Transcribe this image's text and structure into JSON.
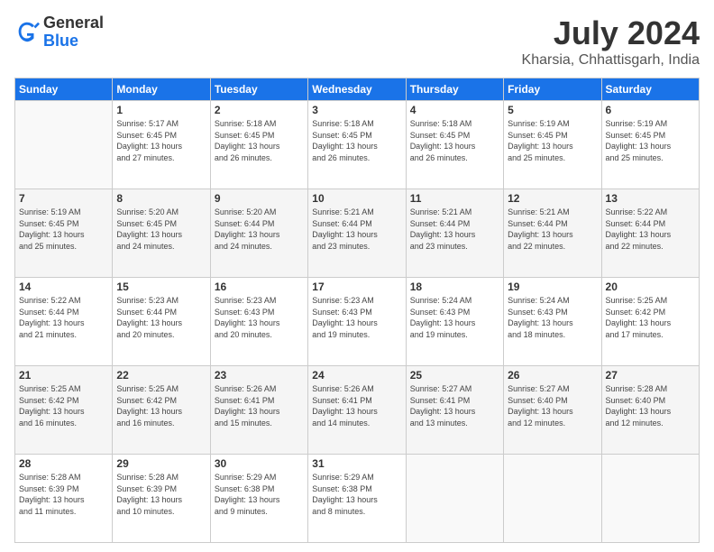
{
  "logo": {
    "general": "General",
    "blue": "Blue"
  },
  "title": "July 2024",
  "subtitle": "Kharsia, Chhattisgarh, India",
  "weekdays": [
    "Sunday",
    "Monday",
    "Tuesday",
    "Wednesday",
    "Thursday",
    "Friday",
    "Saturday"
  ],
  "weeks": [
    [
      {
        "day": "",
        "info": ""
      },
      {
        "day": "1",
        "info": "Sunrise: 5:17 AM\nSunset: 6:45 PM\nDaylight: 13 hours\nand 27 minutes."
      },
      {
        "day": "2",
        "info": "Sunrise: 5:18 AM\nSunset: 6:45 PM\nDaylight: 13 hours\nand 26 minutes."
      },
      {
        "day": "3",
        "info": "Sunrise: 5:18 AM\nSunset: 6:45 PM\nDaylight: 13 hours\nand 26 minutes."
      },
      {
        "day": "4",
        "info": "Sunrise: 5:18 AM\nSunset: 6:45 PM\nDaylight: 13 hours\nand 26 minutes."
      },
      {
        "day": "5",
        "info": "Sunrise: 5:19 AM\nSunset: 6:45 PM\nDaylight: 13 hours\nand 25 minutes."
      },
      {
        "day": "6",
        "info": "Sunrise: 5:19 AM\nSunset: 6:45 PM\nDaylight: 13 hours\nand 25 minutes."
      }
    ],
    [
      {
        "day": "7",
        "info": "Sunrise: 5:19 AM\nSunset: 6:45 PM\nDaylight: 13 hours\nand 25 minutes."
      },
      {
        "day": "8",
        "info": "Sunrise: 5:20 AM\nSunset: 6:45 PM\nDaylight: 13 hours\nand 24 minutes."
      },
      {
        "day": "9",
        "info": "Sunrise: 5:20 AM\nSunset: 6:44 PM\nDaylight: 13 hours\nand 24 minutes."
      },
      {
        "day": "10",
        "info": "Sunrise: 5:21 AM\nSunset: 6:44 PM\nDaylight: 13 hours\nand 23 minutes."
      },
      {
        "day": "11",
        "info": "Sunrise: 5:21 AM\nSunset: 6:44 PM\nDaylight: 13 hours\nand 23 minutes."
      },
      {
        "day": "12",
        "info": "Sunrise: 5:21 AM\nSunset: 6:44 PM\nDaylight: 13 hours\nand 22 minutes."
      },
      {
        "day": "13",
        "info": "Sunrise: 5:22 AM\nSunset: 6:44 PM\nDaylight: 13 hours\nand 22 minutes."
      }
    ],
    [
      {
        "day": "14",
        "info": "Sunrise: 5:22 AM\nSunset: 6:44 PM\nDaylight: 13 hours\nand 21 minutes."
      },
      {
        "day": "15",
        "info": "Sunrise: 5:23 AM\nSunset: 6:44 PM\nDaylight: 13 hours\nand 20 minutes."
      },
      {
        "day": "16",
        "info": "Sunrise: 5:23 AM\nSunset: 6:43 PM\nDaylight: 13 hours\nand 20 minutes."
      },
      {
        "day": "17",
        "info": "Sunrise: 5:23 AM\nSunset: 6:43 PM\nDaylight: 13 hours\nand 19 minutes."
      },
      {
        "day": "18",
        "info": "Sunrise: 5:24 AM\nSunset: 6:43 PM\nDaylight: 13 hours\nand 19 minutes."
      },
      {
        "day": "19",
        "info": "Sunrise: 5:24 AM\nSunset: 6:43 PM\nDaylight: 13 hours\nand 18 minutes."
      },
      {
        "day": "20",
        "info": "Sunrise: 5:25 AM\nSunset: 6:42 PM\nDaylight: 13 hours\nand 17 minutes."
      }
    ],
    [
      {
        "day": "21",
        "info": "Sunrise: 5:25 AM\nSunset: 6:42 PM\nDaylight: 13 hours\nand 16 minutes."
      },
      {
        "day": "22",
        "info": "Sunrise: 5:25 AM\nSunset: 6:42 PM\nDaylight: 13 hours\nand 16 minutes."
      },
      {
        "day": "23",
        "info": "Sunrise: 5:26 AM\nSunset: 6:41 PM\nDaylight: 13 hours\nand 15 minutes."
      },
      {
        "day": "24",
        "info": "Sunrise: 5:26 AM\nSunset: 6:41 PM\nDaylight: 13 hours\nand 14 minutes."
      },
      {
        "day": "25",
        "info": "Sunrise: 5:27 AM\nSunset: 6:41 PM\nDaylight: 13 hours\nand 13 minutes."
      },
      {
        "day": "26",
        "info": "Sunrise: 5:27 AM\nSunset: 6:40 PM\nDaylight: 13 hours\nand 12 minutes."
      },
      {
        "day": "27",
        "info": "Sunrise: 5:28 AM\nSunset: 6:40 PM\nDaylight: 13 hours\nand 12 minutes."
      }
    ],
    [
      {
        "day": "28",
        "info": "Sunrise: 5:28 AM\nSunset: 6:39 PM\nDaylight: 13 hours\nand 11 minutes."
      },
      {
        "day": "29",
        "info": "Sunrise: 5:28 AM\nSunset: 6:39 PM\nDaylight: 13 hours\nand 10 minutes."
      },
      {
        "day": "30",
        "info": "Sunrise: 5:29 AM\nSunset: 6:38 PM\nDaylight: 13 hours\nand 9 minutes."
      },
      {
        "day": "31",
        "info": "Sunrise: 5:29 AM\nSunset: 6:38 PM\nDaylight: 13 hours\nand 8 minutes."
      },
      {
        "day": "",
        "info": ""
      },
      {
        "day": "",
        "info": ""
      },
      {
        "day": "",
        "info": ""
      }
    ]
  ]
}
